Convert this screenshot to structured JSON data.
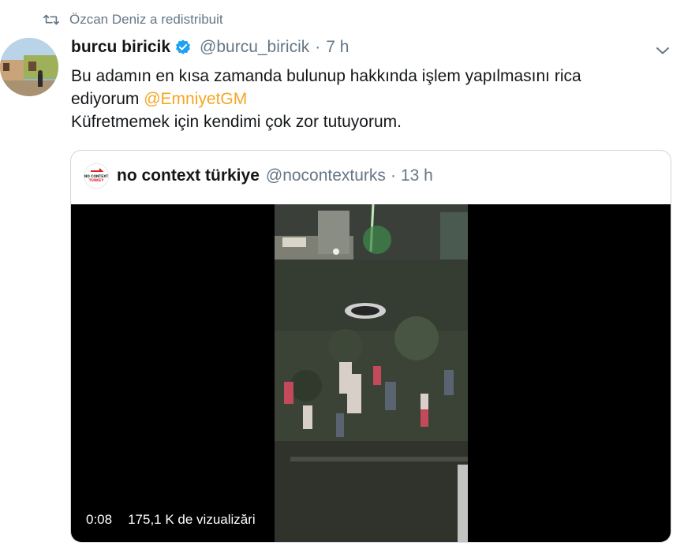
{
  "retweet": {
    "icon": "retweet-icon",
    "text": "Özcan Deniz a redistribuit"
  },
  "tweet": {
    "author_name": "burcu biricik",
    "handle": "@burcu_biricik",
    "separator": "·",
    "time": "7 h",
    "text_line1": "Bu adamın en kısa zamanda bulunup hakkında işlem yapılmasını rica",
    "text_line2_prefix": "ediyorum ",
    "mention": "@EmniyetGM",
    "text_line3": "Küfretmemek için kendimi çok zor tutuyorum.",
    "mention_color": "#f5a623"
  },
  "quote": {
    "author_name": "no context türkiye",
    "handle": "@nocontexturks",
    "separator": "·",
    "time": "13 h",
    "avatar_text": "NO CONTEXT TURKEY",
    "video": {
      "duration": "0:08",
      "views": "175,1 K de vizualizări"
    }
  },
  "colors": {
    "text": "#14171a",
    "muted": "#657786",
    "verified": "#1da1f2",
    "border": "#ccd6dd"
  }
}
